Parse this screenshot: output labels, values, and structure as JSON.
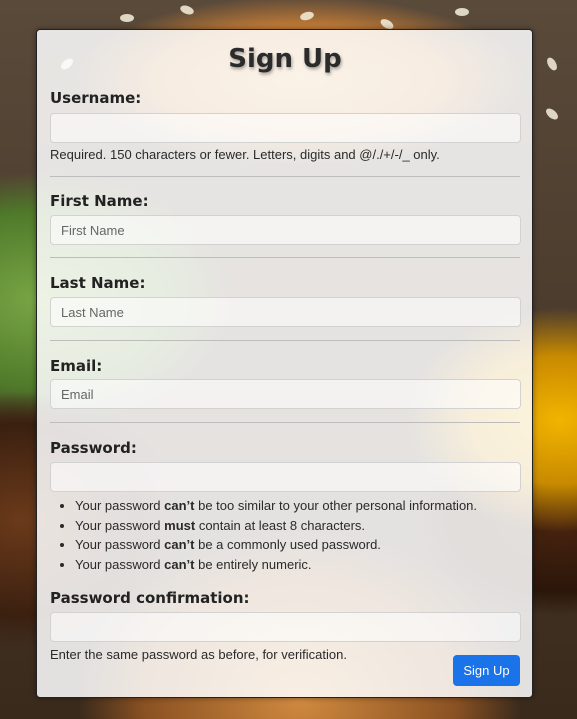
{
  "form": {
    "title": "Sign Up",
    "username": {
      "label": "Username:",
      "value": "",
      "placeholder": "",
      "help": "Required. 150 characters or fewer. Letters, digits and @/./+/-/_ only."
    },
    "first_name": {
      "label": "First Name:",
      "value": "",
      "placeholder": "First Name"
    },
    "last_name": {
      "label": "Last Name:",
      "value": "",
      "placeholder": "Last Name"
    },
    "email": {
      "label": "Email:",
      "value": "",
      "placeholder": "Email"
    },
    "password": {
      "label": "Password:",
      "value": "",
      "placeholder": "",
      "rules": [
        {
          "pre": "Your password ",
          "bold": "can’t",
          "post": " be too similar to your other personal information."
        },
        {
          "pre": "Your password ",
          "bold": "must",
          "post": " contain at least 8 characters."
        },
        {
          "pre": "Your password ",
          "bold": "can’t",
          "post": " be a commonly used password."
        },
        {
          "pre": "Your password ",
          "bold": "can’t",
          "post": " be entirely numeric."
        }
      ]
    },
    "password_confirmation": {
      "label": "Password confirmation:",
      "value": "",
      "placeholder": "",
      "help": "Enter the same password as before, for verification."
    },
    "submit_label": "Sign Up"
  },
  "colors": {
    "primary_button": "#1a73e8",
    "card_background": "rgba(255,255,255,0.86)"
  },
  "background": {
    "description_icon": "burger-background-image"
  }
}
